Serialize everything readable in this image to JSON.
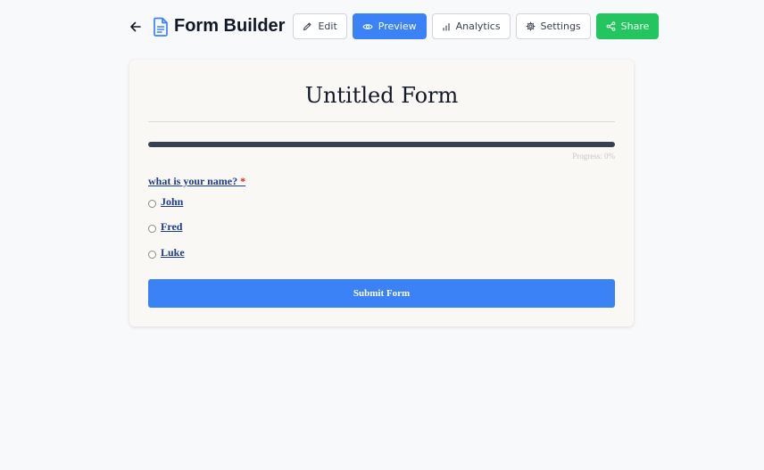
{
  "header": {
    "title": "Form Builder",
    "actions": [
      {
        "label": "Edit",
        "icon": "pencil-icon"
      },
      {
        "label": "Preview",
        "icon": "eye-icon",
        "active": true
      },
      {
        "label": "Analytics",
        "icon": "bar-chart-icon"
      },
      {
        "label": "Settings",
        "icon": "gear-icon"
      },
      {
        "label": "Share",
        "icon": "share-icon"
      }
    ]
  },
  "form": {
    "title": "Untitled Form",
    "progress_text": "Progress: 0%",
    "progress_value": 0,
    "question": {
      "label": "what is your name?",
      "required_marker": "*",
      "options": [
        "John",
        "Fred",
        "Luke"
      ]
    },
    "submit_label": "Submit Form"
  },
  "colors": {
    "primary": "#3b82f6",
    "success": "#22c55e",
    "progress_track": "#374151",
    "link_text": "#1e3a8a",
    "required": "#dc2626",
    "card_bg": "#faf8f4",
    "page_bg": "#f8f9fb"
  }
}
